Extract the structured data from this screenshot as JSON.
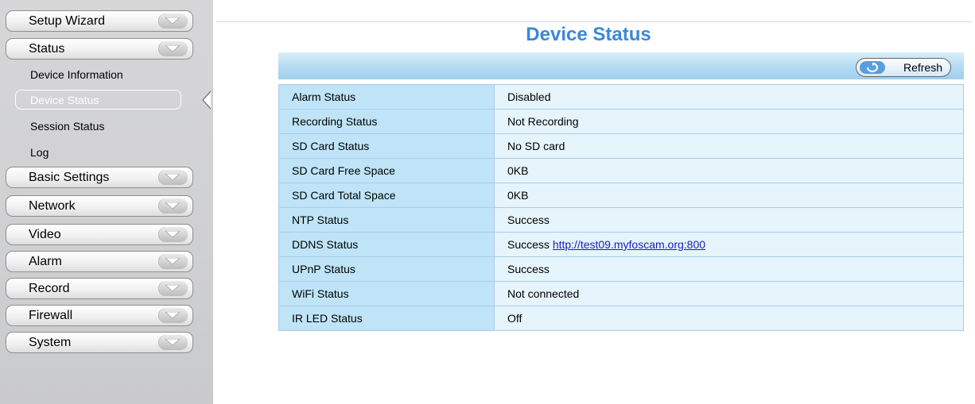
{
  "sidebar": {
    "top_menu": [
      "Setup Wizard",
      "Status"
    ],
    "status_sub": [
      "Device Information",
      "Device Status",
      "Session Status",
      "Log"
    ],
    "active_sub": "Device Status",
    "bottom_menu": [
      "Basic Settings",
      "Network",
      "Video",
      "Alarm",
      "Record",
      "Firewall",
      "System"
    ]
  },
  "main": {
    "title": "Device Status",
    "refresh_label": "Refresh",
    "rows": [
      {
        "label": "Alarm Status",
        "value": "Disabled"
      },
      {
        "label": "Recording Status",
        "value": "Not Recording"
      },
      {
        "label": "SD Card Status",
        "value": "No SD card"
      },
      {
        "label": "SD Card Free Space",
        "value": "0KB"
      },
      {
        "label": "SD Card Total Space",
        "value": "0KB"
      },
      {
        "label": "NTP Status",
        "value": "Success"
      },
      {
        "label": "DDNS Status",
        "value": "Success",
        "link": "http://test09.myfoscam.org:800"
      },
      {
        "label": "UPnP Status",
        "value": "Success"
      },
      {
        "label": "WiFi Status",
        "value": "Not connected"
      },
      {
        "label": "IR LED Status",
        "value": "Off"
      }
    ]
  },
  "colors": {
    "title": "#3a88d8",
    "label_cell": "#bfe4f7",
    "value_cell": "#e6f4fc",
    "link": "#1a1acc",
    "sidebar": "#cfd0d2"
  },
  "icons": {
    "menu_chevron": "chevron-down-icon",
    "refresh": "refresh-icon",
    "pointer": "active-pointer-icon"
  }
}
